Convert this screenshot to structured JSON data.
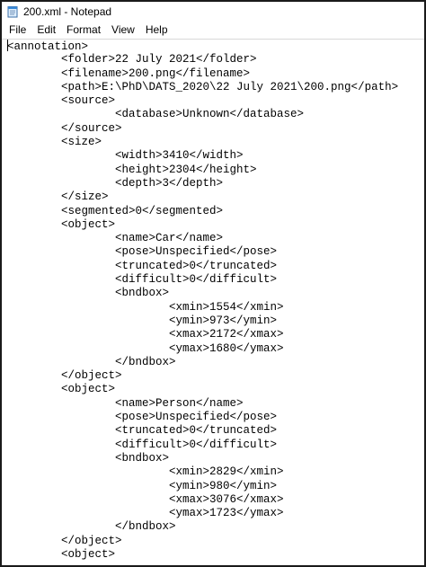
{
  "window": {
    "title": "200.xml - Notepad",
    "icon": "notepad-icon"
  },
  "menu": {
    "items": [
      "File",
      "Edit",
      "Format",
      "View",
      "Help"
    ]
  },
  "editor": {
    "lines": [
      "<annotation>",
      "        <folder>22 July 2021</folder>",
      "        <filename>200.png</filename>",
      "        <path>E:\\PhD\\DATS_2020\\22 July 2021\\200.png</path>",
      "        <source>",
      "                <database>Unknown</database>",
      "        </source>",
      "        <size>",
      "                <width>3410</width>",
      "                <height>2304</height>",
      "                <depth>3</depth>",
      "        </size>",
      "        <segmented>0</segmented>",
      "        <object>",
      "                <name>Car</name>",
      "                <pose>Unspecified</pose>",
      "                <truncated>0</truncated>",
      "                <difficult>0</difficult>",
      "                <bndbox>",
      "                        <xmin>1554</xmin>",
      "                        <ymin>973</ymin>",
      "                        <xmax>2172</xmax>",
      "                        <ymax>1680</ymax>",
      "                </bndbox>",
      "        </object>",
      "        <object>",
      "                <name>Person</name>",
      "                <pose>Unspecified</pose>",
      "                <truncated>0</truncated>",
      "                <difficult>0</difficult>",
      "                <bndbox>",
      "                        <xmin>2829</xmin>",
      "                        <ymin>980</ymin>",
      "                        <xmax>3076</xmax>",
      "                        <ymax>1723</ymax>",
      "                </bndbox>",
      "        </object>",
      "        <object>"
    ]
  }
}
